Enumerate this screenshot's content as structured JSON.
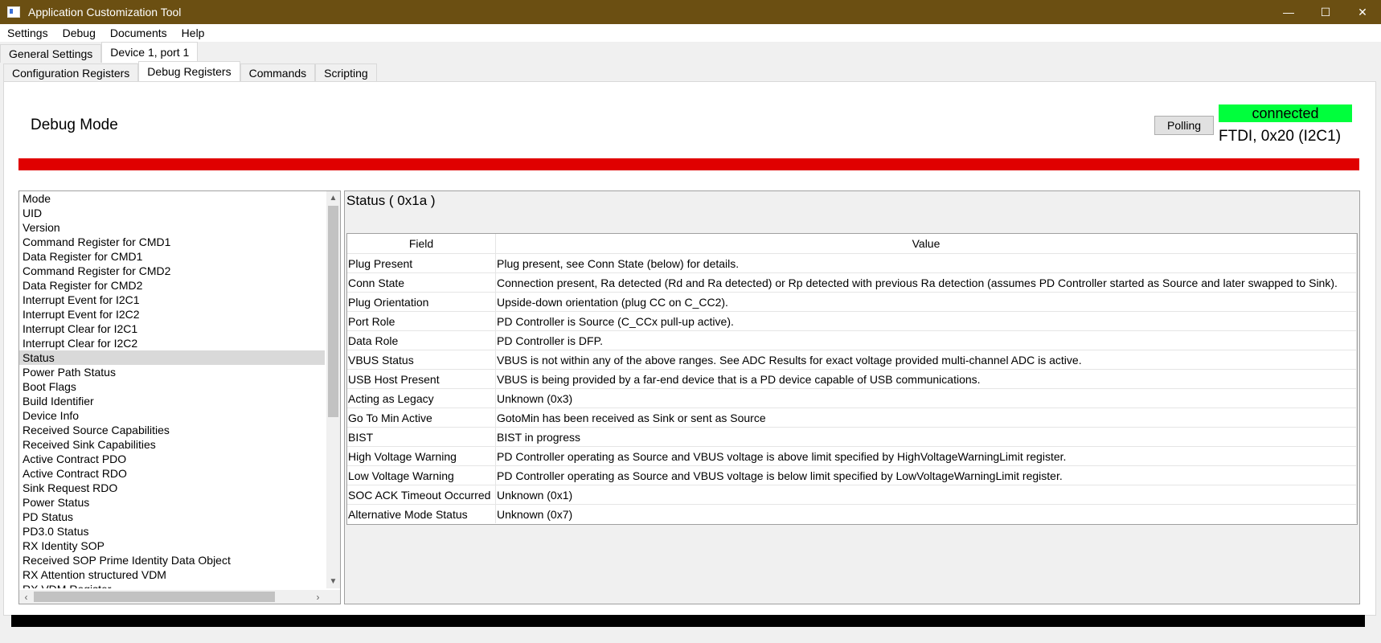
{
  "window": {
    "title": "Application Customization Tool",
    "controls": [
      "—",
      "☐",
      "✕"
    ]
  },
  "menu": [
    "Settings",
    "Debug",
    "Documents",
    "Help"
  ],
  "top_tabs": [
    {
      "label": "General Settings",
      "active": false
    },
    {
      "label": "Device 1, port 1",
      "active": true
    }
  ],
  "sub_tabs": [
    {
      "label": "Configuration Registers",
      "active": false
    },
    {
      "label": "Debug Registers",
      "active": true
    },
    {
      "label": "Commands",
      "active": false
    },
    {
      "label": "Scripting",
      "active": false
    }
  ],
  "header": {
    "mode_label": "Debug Mode",
    "polling_label": "Polling",
    "connection_status": "connected",
    "connection_info": "FTDI, 0x20 (I2C1)"
  },
  "colors": {
    "titlebar": "#6b4f12",
    "status_bar": "#e00000",
    "connected": "#00ff3c"
  },
  "register_list": {
    "selected": "Status",
    "items": [
      "Mode",
      "UID",
      "Version",
      "Command Register for CMD1",
      "Data Register for CMD1",
      "Command Register for CMD2",
      "Data Register for CMD2",
      "Interrupt Event for I2C1",
      "Interrupt Event for I2C2",
      "Interrupt Clear for I2C1",
      "Interrupt Clear for I2C2",
      "Status",
      "Power Path Status",
      "Boot Flags",
      "Build Identifier",
      "Device Info",
      "Received Source Capabilities",
      "Received Sink Capabilities",
      "Active Contract PDO",
      "Active Contract RDO",
      "Sink Request RDO",
      "Power Status",
      "PD Status",
      "PD3.0 Status",
      "RX Identity SOP",
      "Received SOP Prime Identity Data Object",
      "RX Attention structured VDM",
      "RX VDM Register"
    ]
  },
  "register_detail": {
    "title": "Status  ( 0x1a )",
    "columns": [
      "Field",
      "Value"
    ],
    "rows": [
      {
        "field": "Plug Present",
        "value": "Plug present, see Conn State (below) for details."
      },
      {
        "field": "Conn State",
        "value": "Connection present, Ra detected (Rd and Ra detected) or Rp detected with previous Ra detection (assumes PD Controller started as Source and later swapped to Sink)."
      },
      {
        "field": "Plug Orientation",
        "value": "Upside-down orientation (plug CC on C_CC2)."
      },
      {
        "field": "Port Role",
        "value": "PD Controller is Source (C_CCx pull-up active)."
      },
      {
        "field": "Data Role",
        "value": "PD Controller is DFP."
      },
      {
        "field": "VBUS Status",
        "value": "VBUS is not within any of the above ranges. See ADC Results for exact voltage provided multi-channel ADC is active."
      },
      {
        "field": "USB Host Present",
        "value": "VBUS is being provided by a far-end device that is a PD device capable of USB communications."
      },
      {
        "field": "Acting as Legacy",
        "value": "Unknown (0x3)"
      },
      {
        "field": "Go To Min Active",
        "value": "GotoMin has been received as Sink or sent as Source"
      },
      {
        "field": "BIST",
        "value": "BIST in progress"
      },
      {
        "field": "High Voltage Warning",
        "value": "PD Controller operating as Source and VBUS voltage is above limit specified by HighVoltageWarningLimit register."
      },
      {
        "field": "Low Voltage Warning",
        "value": "PD Controller operating as Source and VBUS voltage is below limit specified by LowVoltageWarningLimit register."
      },
      {
        "field": "SOC ACK Timeout Occurred",
        "value": "Unknown (0x1)"
      },
      {
        "field": "Alternative Mode Status",
        "value": "Unknown (0x7)"
      }
    ]
  }
}
